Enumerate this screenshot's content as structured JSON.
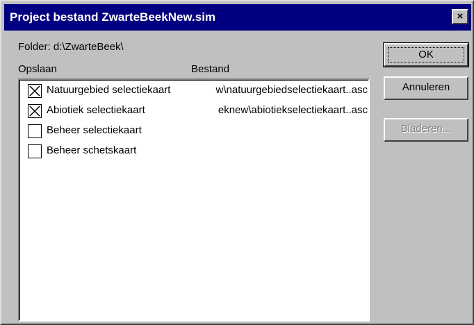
{
  "window": {
    "title": "Project bestand ZwarteBeekNew.sim",
    "close_glyph": "×"
  },
  "folder": {
    "label": "Folder: d:\\ZwarteBeek\\"
  },
  "columns": {
    "save": "Opslaan",
    "file": "Bestand"
  },
  "rows": [
    {
      "name": "Natuurgebied selectiekaart",
      "checked": true,
      "file": "w\\natuurgebiedselectiekaart..asc"
    },
    {
      "name": "Abiotiek selectiekaart",
      "checked": true,
      "file": "eknew\\abiotiekselectiekaart..asc"
    },
    {
      "name": "Beheer selectiekaart",
      "checked": false,
      "file": ""
    },
    {
      "name": "Beheer schetskaart",
      "checked": false,
      "file": ""
    }
  ],
  "buttons": {
    "ok": "OK",
    "cancel": "Annuleren",
    "browse": "Bladeren..."
  },
  "colors": {
    "titlebar": "#000080",
    "face": "#c0c0c0",
    "disabled_text": "#808080"
  }
}
